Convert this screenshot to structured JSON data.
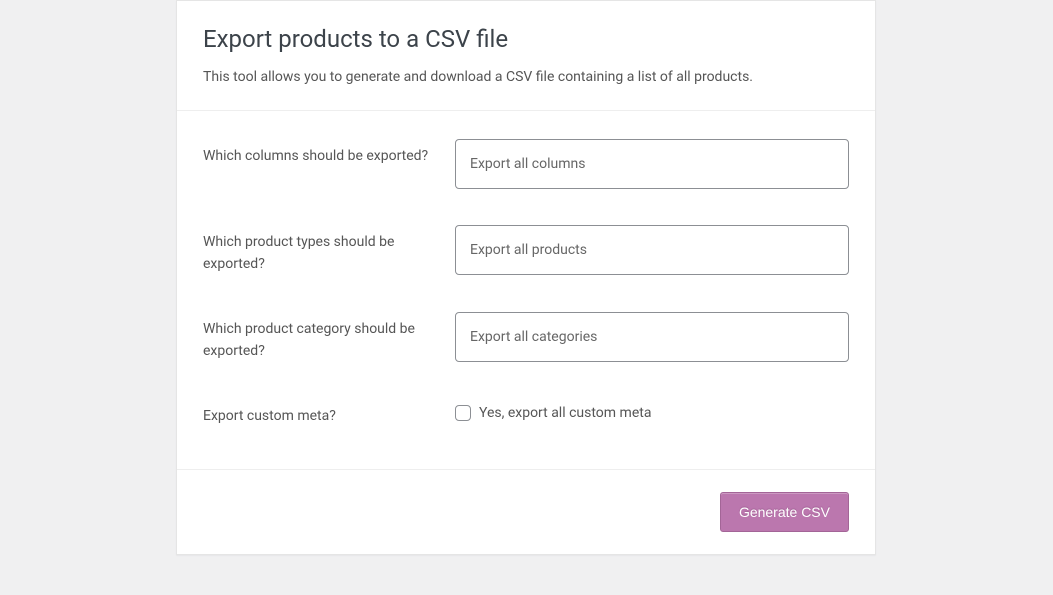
{
  "header": {
    "title": "Export products to a CSV file",
    "description": "This tool allows you to generate and download a CSV file containing a list of all products."
  },
  "form": {
    "columns": {
      "label": "Which columns should be exported?",
      "placeholder": "Export all columns"
    },
    "product_types": {
      "label": "Which product types should be exported?",
      "placeholder": "Export all products"
    },
    "category": {
      "label": "Which product category should be exported?",
      "placeholder": "Export all categories"
    },
    "custom_meta": {
      "label": "Export custom meta?",
      "checkbox_label": "Yes, export all custom meta"
    }
  },
  "footer": {
    "submit_label": "Generate CSV"
  }
}
